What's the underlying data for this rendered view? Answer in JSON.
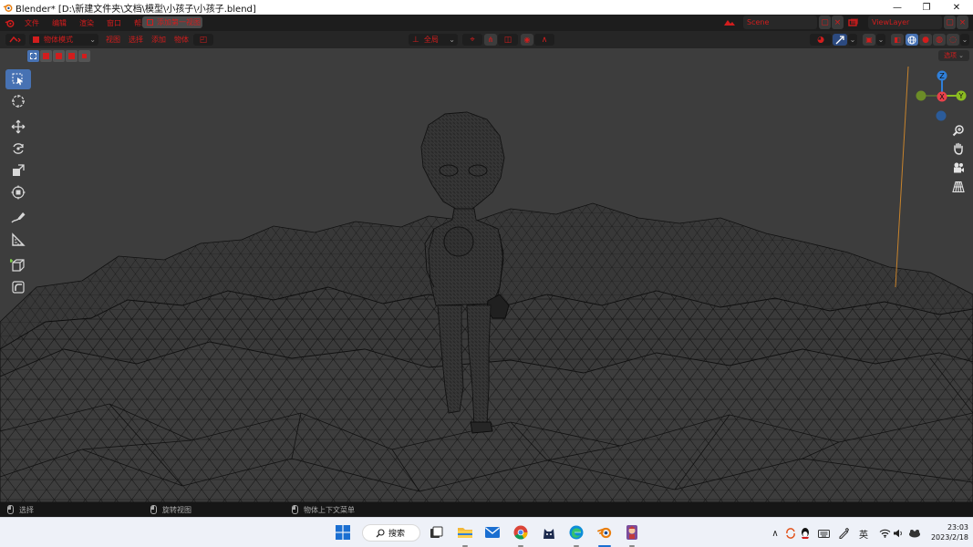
{
  "window": {
    "title": "Blender* [D:\\新建文件夹\\文档\\模型\\小孩子\\小孩子.blend]",
    "minimize_glyph": "—",
    "maximize_glyph": "❐",
    "close_glyph": "✕"
  },
  "menu": {
    "items": [
      "文件",
      "编辑",
      "渲染",
      "窗口",
      "帮助"
    ],
    "workspace_tab": "添加第一视图",
    "scene": "Scene",
    "view_layer": "ViewLayer"
  },
  "header": {
    "mode": "物体模式",
    "menus": [
      "视图",
      "选择",
      "添加",
      "物体"
    ],
    "transform_orientation": "全局"
  },
  "viewport": {
    "options_label": "选项",
    "gizmo": {
      "x": "X",
      "y": "Y",
      "z": "Z"
    }
  },
  "statusbar": {
    "left_click": "选择",
    "middle_click": "旋转视图",
    "right_click": "物体上下文菜单"
  },
  "taskbar": {
    "search_label": "搜索",
    "ime_label": "英",
    "time": "23:03",
    "date": "2023/2/18"
  },
  "colors": {
    "accent_red": "#d21d1d",
    "active_blue": "#4772b3",
    "viewport_bg": "#3d3d3d",
    "axis_x": "#e8414b",
    "axis_y": "#8bbc21",
    "axis_z": "#2f7fd9"
  }
}
